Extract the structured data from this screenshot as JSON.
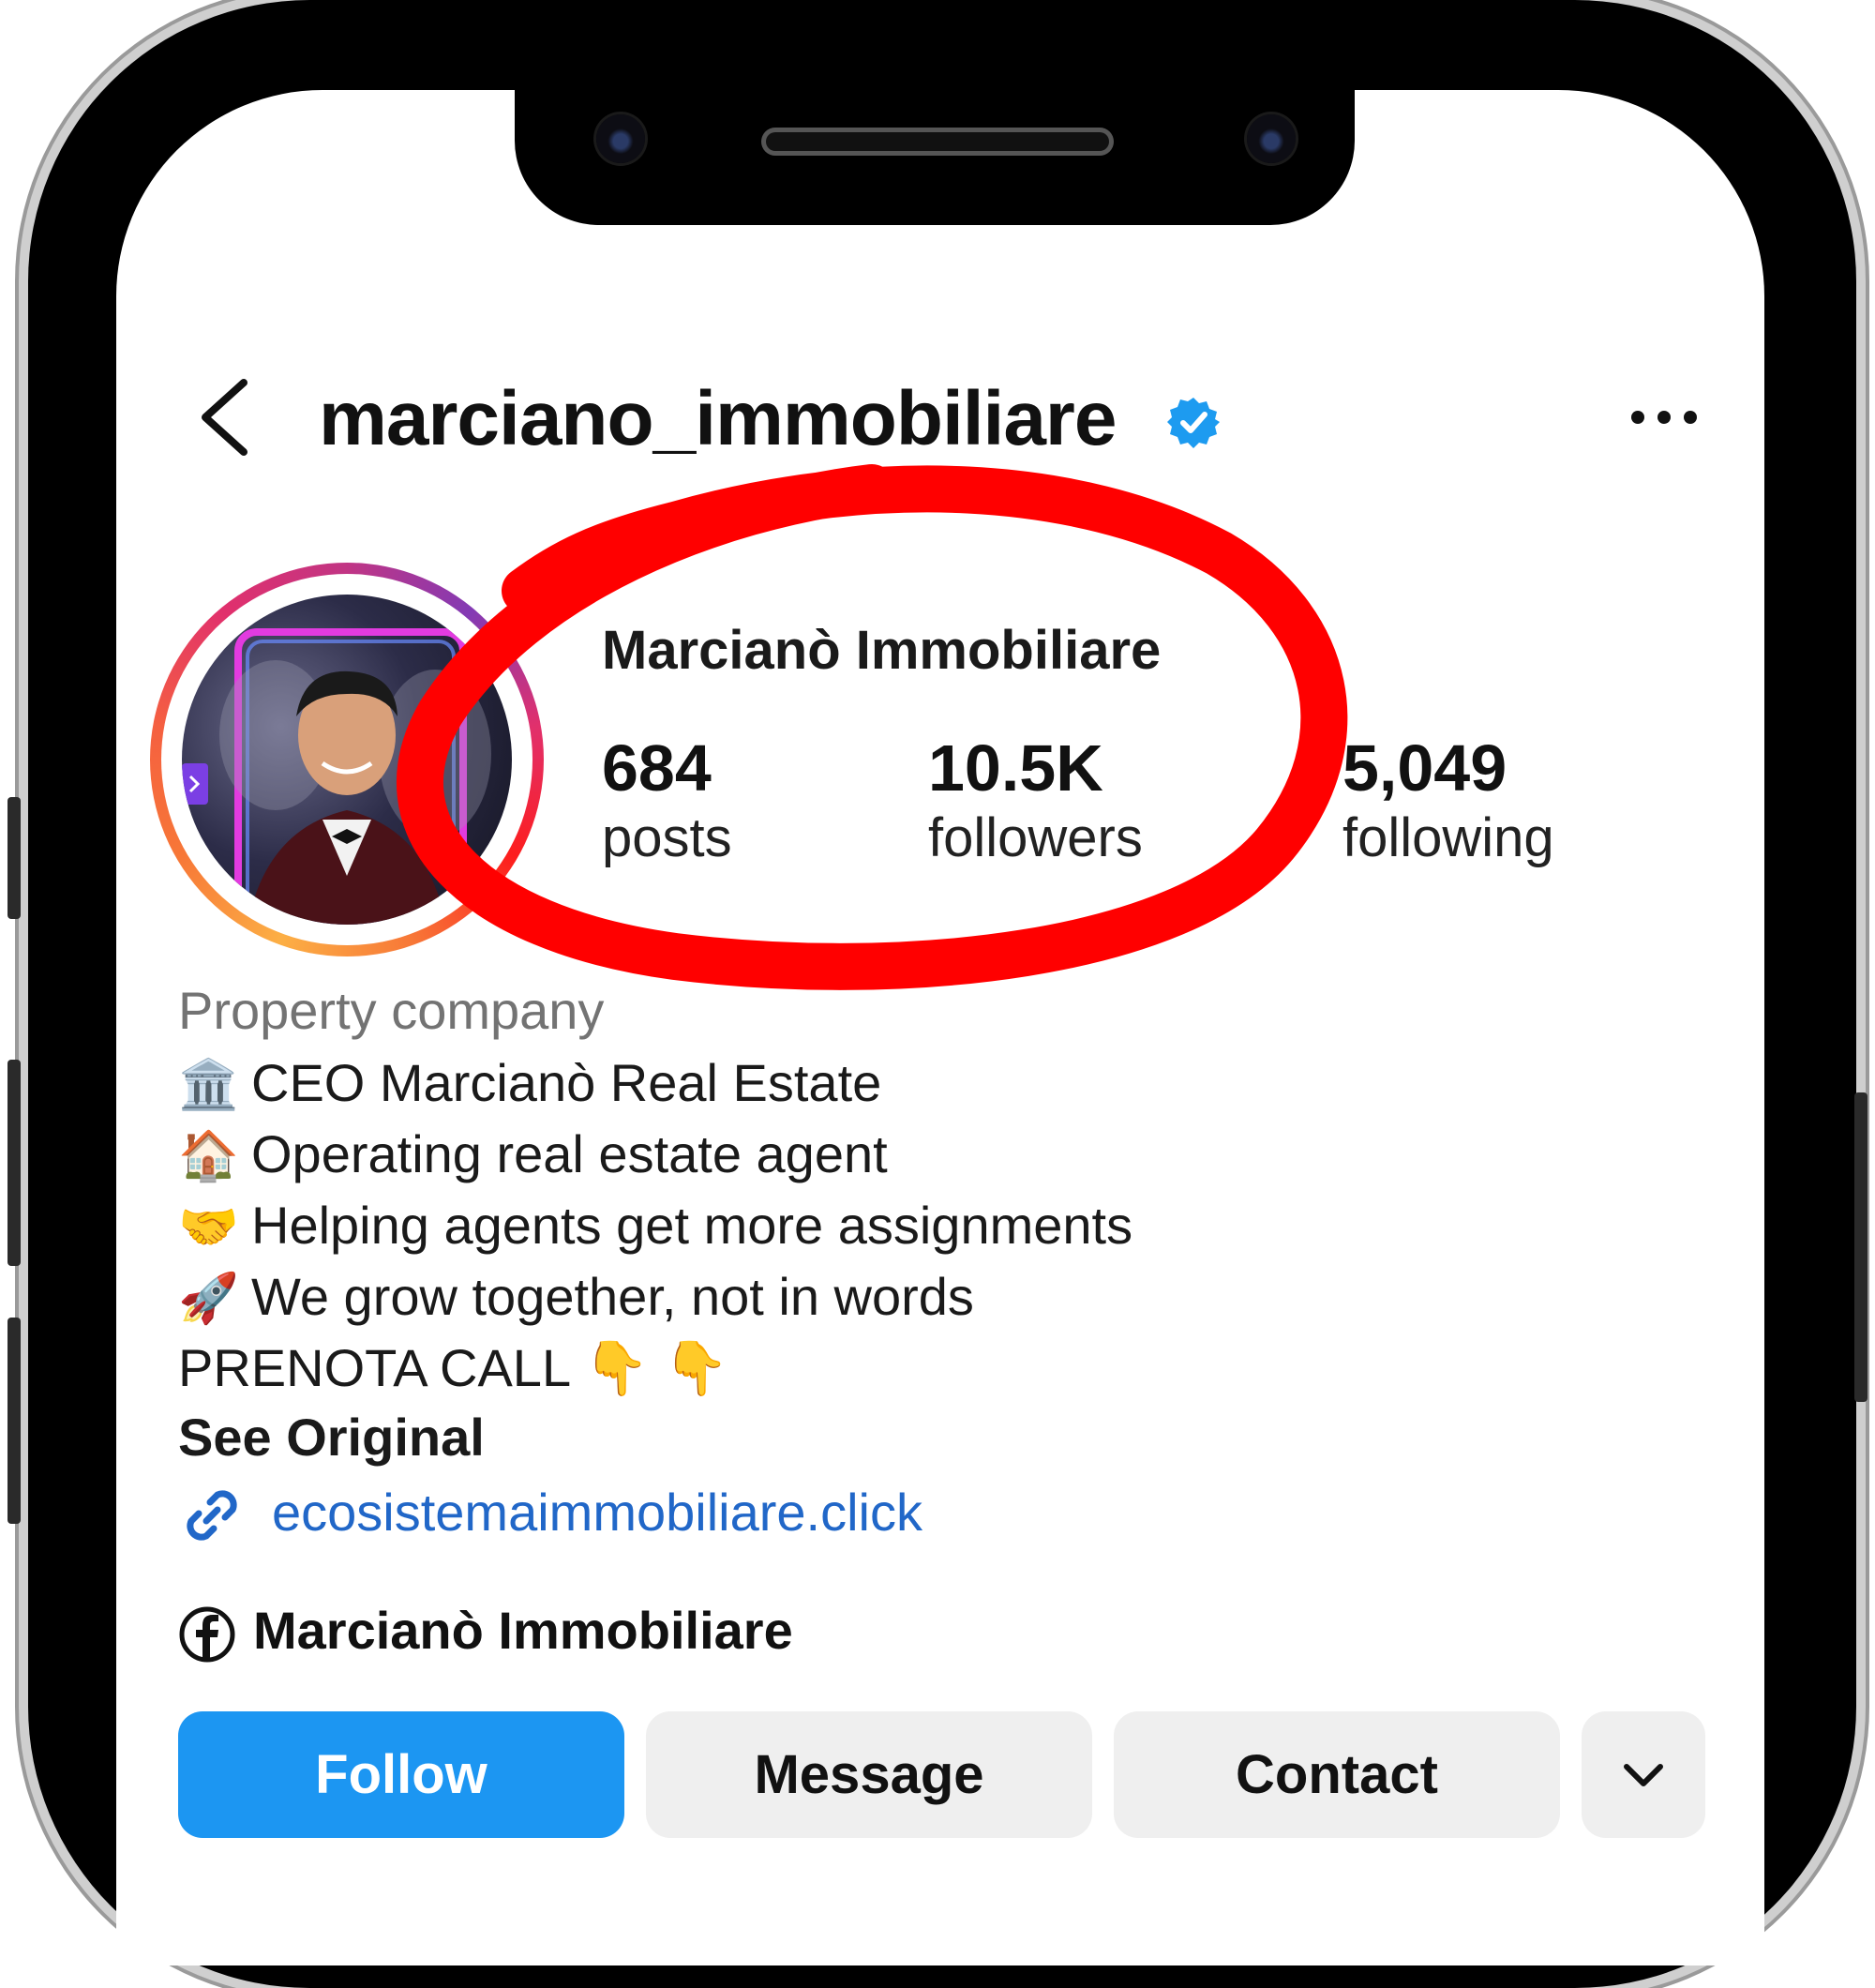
{
  "header": {
    "username": "marciano_immobiliare",
    "back_icon": "chevron-left-icon",
    "verified_icon": "verified-badge-icon",
    "more_icon": "more-horizontal-icon"
  },
  "profile": {
    "display_name": "Marcianò Immobiliare",
    "stats": [
      {
        "value": "684",
        "label": "posts"
      },
      {
        "value": "10.5K",
        "label": "followers"
      },
      {
        "value": "5,049",
        "label": "following"
      }
    ],
    "category": "Property company",
    "bio": [
      {
        "emoji": "🏛️",
        "text": "CEO Marcianò Real Estate"
      },
      {
        "emoji": "🏠",
        "text": "Operating real estate agent"
      },
      {
        "emoji": "🤝",
        "text": "Helping agents get more assignments"
      },
      {
        "emoji": "🚀",
        "text": "We grow together, not in words"
      },
      {
        "emoji": "",
        "text": " PRENOTA CALL  👇 👇"
      }
    ],
    "see_original": "See Original",
    "link": "ecosistemaimmobiliare.click",
    "facebook_name": "Marcianò Immobiliare"
  },
  "actions": {
    "follow": "Follow",
    "message": "Message",
    "contact": "Contact",
    "more_icon": "chevron-down-icon"
  },
  "colors": {
    "follow_blue": "#1c96f2",
    "link_blue": "#2167c8",
    "verified_blue": "#1d9bf0",
    "annotation_red": "#ff0000",
    "button_gray": "#efefef"
  }
}
